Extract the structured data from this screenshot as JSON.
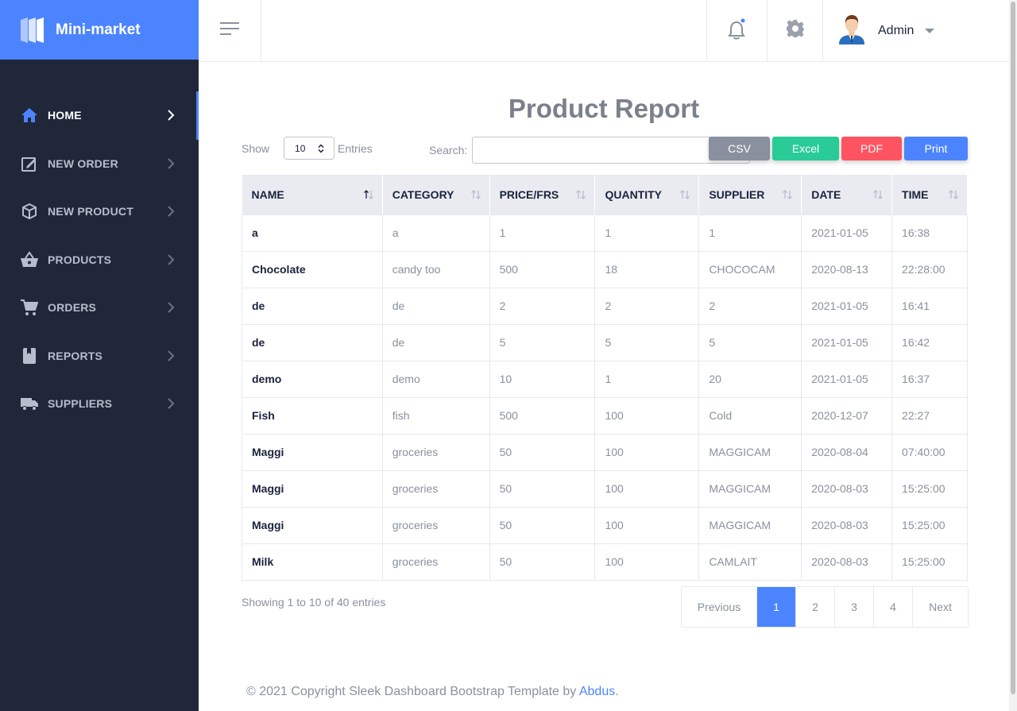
{
  "brand": {
    "name": "Mini-market"
  },
  "sidebar": {
    "items": [
      {
        "label": "HOME",
        "icon": "home-icon",
        "active": true
      },
      {
        "label": "NEW ORDER",
        "icon": "edit-note-icon"
      },
      {
        "label": "NEW PRODUCT",
        "icon": "box-icon"
      },
      {
        "label": "PRODUCTS",
        "icon": "basket-icon"
      },
      {
        "label": "ORDERS",
        "icon": "cart-icon"
      },
      {
        "label": "REPORTS",
        "icon": "book-icon"
      },
      {
        "label": "SUPPLIERS",
        "icon": "truck-icon"
      }
    ]
  },
  "header": {
    "user_name": "Admin",
    "icons": [
      "menu-icon",
      "bell-icon",
      "gear-icon",
      "avatar"
    ]
  },
  "page": {
    "title": "Product Report"
  },
  "controls": {
    "show_label": "Show",
    "length_value": "10",
    "entries_label": "Entries",
    "search_label": "Search:",
    "search_value": "",
    "buttons": {
      "csv": "CSV",
      "excel": "Excel",
      "pdf": "PDF",
      "print": "Print"
    }
  },
  "table": {
    "columns": [
      "NAME",
      "CATEGORY",
      "PRICE/FRS",
      "QUANTITY",
      "SUPPLIER",
      "DATE",
      "TIME"
    ],
    "rows": [
      [
        "a",
        "a",
        "1",
        "1",
        "1",
        "2021-01-05",
        "16:38"
      ],
      [
        "Chocolate",
        "candy too",
        "500",
        "18",
        "CHOCOCAM",
        "2020-08-13",
        "22:28:00"
      ],
      [
        "de",
        "de",
        "2",
        "2",
        "2",
        "2021-01-05",
        "16:41"
      ],
      [
        "de",
        "de",
        "5",
        "5",
        "5",
        "2021-01-05",
        "16:42"
      ],
      [
        "demo",
        "demo",
        "10",
        "1",
        "20",
        "2021-01-05",
        "16:37"
      ],
      [
        "Fish",
        "fish",
        "500",
        "100",
        "Cold",
        "2020-12-07",
        "22:27"
      ],
      [
        "Maggi",
        "groceries",
        "50",
        "100",
        "MAGGICAM",
        "2020-08-04",
        "07:40:00"
      ],
      [
        "Maggi",
        "groceries",
        "50",
        "100",
        "MAGGICAM",
        "2020-08-03",
        "15:25:00"
      ],
      [
        "Maggi",
        "groceries",
        "50",
        "100",
        "MAGGICAM",
        "2020-08-03",
        "15:25:00"
      ],
      [
        "Milk",
        "groceries",
        "50",
        "100",
        "CAMLAIT",
        "2020-08-03",
        "15:25:00"
      ]
    ]
  },
  "pagination": {
    "info": "Showing 1 to 10 of 40 entries",
    "previous": "Previous",
    "pages": [
      "1",
      "2",
      "3",
      "4"
    ],
    "active_page": "1",
    "next": "Next"
  },
  "footer": {
    "text": "© 2021 Copyright Sleek Dashboard Bootstrap Template by ",
    "link": "Abdus",
    "suffix": "."
  },
  "colors": {
    "accent": "#4c84ff",
    "sidebar_bg": "#1f2739",
    "csv": "#8a909d",
    "excel": "#29cc97",
    "pdf": "#fe5461",
    "print": "#4c84ff"
  }
}
